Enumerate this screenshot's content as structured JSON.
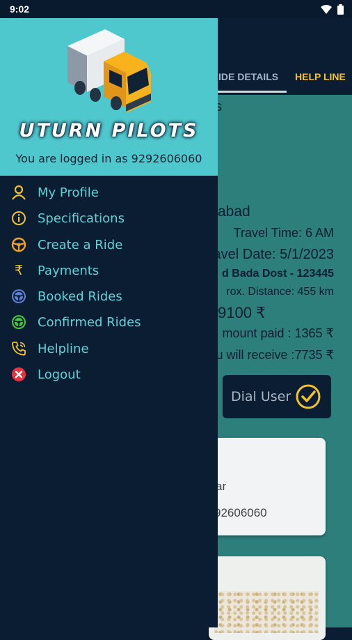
{
  "status_bar": {
    "time": "9:02"
  },
  "drawer": {
    "brand": "UTURN PILOTS",
    "logged_in_text": "You are logged in as 9292606060",
    "menu": [
      {
        "label": "My Profile",
        "icon": "person-icon"
      },
      {
        "label": "Specifications",
        "icon": "info-icon"
      },
      {
        "label": "Create a Ride",
        "icon": "steering-wheel-icon"
      },
      {
        "label": "Payments",
        "icon": "rupee-icon"
      },
      {
        "label": "Booked Rides",
        "icon": "steering-wheel-icon"
      },
      {
        "label": "Confirmed Rides",
        "icon": "steering-wheel-icon"
      },
      {
        "label": "Helpline",
        "icon": "phone-call-icon"
      },
      {
        "label": "Logout",
        "icon": "close-circle-icon"
      }
    ]
  },
  "background": {
    "tabs": [
      "IDE DETAILS",
      "HELP LINE"
    ],
    "partial_s": "s",
    "city": "abad",
    "travel_time": "Travel Time: 6 AM",
    "travel_date": "avel Date: 5/1/2023",
    "user_line": "d Bada Dost - 123445",
    "distance": "rox. Distance: 455 km",
    "price": "9100 ₹",
    "amount_paid": "mount paid : 1365 ₹",
    "receive": "u will receive :7735 ₹",
    "dial_label": "Dial User",
    "card_line1": "ar",
    "card_line2": "92606060"
  },
  "colors": {
    "drawer_bg": "#0b1d33",
    "header_bg": "#4fc8cd",
    "menu_text": "#5fd3d8",
    "accent": "#f2c230",
    "teal_bg": "#2d7f7c"
  }
}
